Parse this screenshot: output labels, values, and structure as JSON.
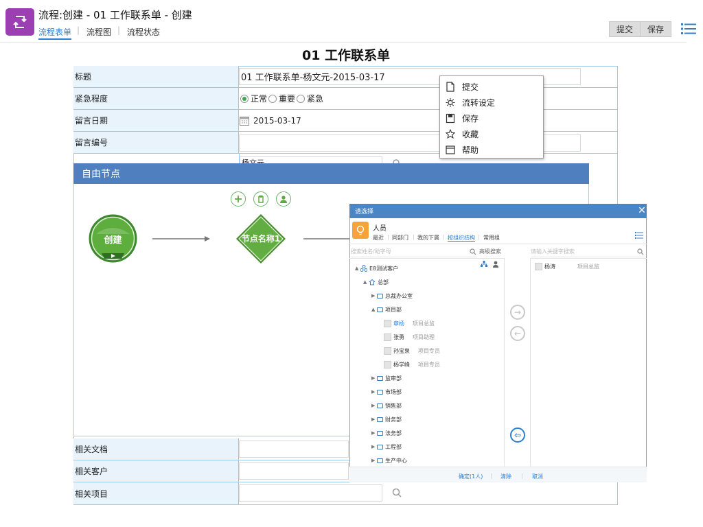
{
  "header": {
    "title": "流程:创建 - 01 工作联系单 - 创建",
    "tabs": [
      {
        "label": "流程表单",
        "active": true
      },
      {
        "label": "流程图",
        "active": false
      },
      {
        "label": "流程状态",
        "active": false
      }
    ],
    "submit_label": "提交",
    "save_label": "保存",
    "app_icon": "workflow-icon",
    "accent": "#2a7fd4"
  },
  "form": {
    "title": "01 工作联系单",
    "rows": {
      "title_label": "标题",
      "title_value": "01 工作联系单-杨文元-2015-03-17",
      "urgency_label": "紧急程度",
      "urgency_options": [
        "正常",
        "重要",
        "紧急"
      ],
      "urgency_selected": "正常",
      "date_label": "留言日期",
      "date_value": "2015-03-17",
      "number_label": "留言编号",
      "number_value": "",
      "partial_value": "杨文元",
      "docs_label": "相关文档",
      "customer_label": "相关客户",
      "project_label": "相关项目"
    }
  },
  "context_menu": {
    "items": [
      {
        "label": "提交",
        "icon": "document-icon"
      },
      {
        "label": "流转设定",
        "icon": "gear-icon"
      },
      {
        "label": "保存",
        "icon": "floppy-icon"
      },
      {
        "label": "收藏",
        "icon": "star-icon"
      },
      {
        "label": "帮助",
        "icon": "window-icon"
      }
    ]
  },
  "free_node": {
    "title": "自由节点",
    "start_node": "创建",
    "node_name": "节点名称1",
    "node_color": "#5fa83f",
    "header_color": "#4f7fbf"
  },
  "selector": {
    "title": "请选择",
    "category": "人员",
    "tabs": [
      "最近",
      "同部门",
      "我的下属",
      "按组织结构",
      "常用组"
    ],
    "active_tab": "按组织结构",
    "search_placeholder": "搜索姓名/助字母",
    "advanced_search": "高级搜索",
    "keyword_placeholder": "请输入关键字搜索",
    "tree": {
      "root": "E8测试客户",
      "company": "总部",
      "departments_before": [
        "总裁办公室"
      ],
      "expanded_dept": "项目部",
      "members": [
        {
          "name": "章杨",
          "role": "项目总监",
          "highlight": true
        },
        {
          "name": "张勇",
          "role": "项目助理",
          "highlight": false
        },
        {
          "name": "孙宝泉",
          "role": "项目专员",
          "highlight": false
        },
        {
          "name": "杨学峰",
          "role": "项目专员",
          "highlight": false
        }
      ],
      "departments_after": [
        "监审部",
        "市场部",
        "销售部",
        "财务部",
        "法务部",
        "工程部",
        "生产中心"
      ]
    },
    "selected": [
      {
        "name": "杨涛",
        "role": "项目总监"
      }
    ],
    "confirm_label": "确定(1人)",
    "clear_label": "清除",
    "cancel_label": "取消"
  }
}
